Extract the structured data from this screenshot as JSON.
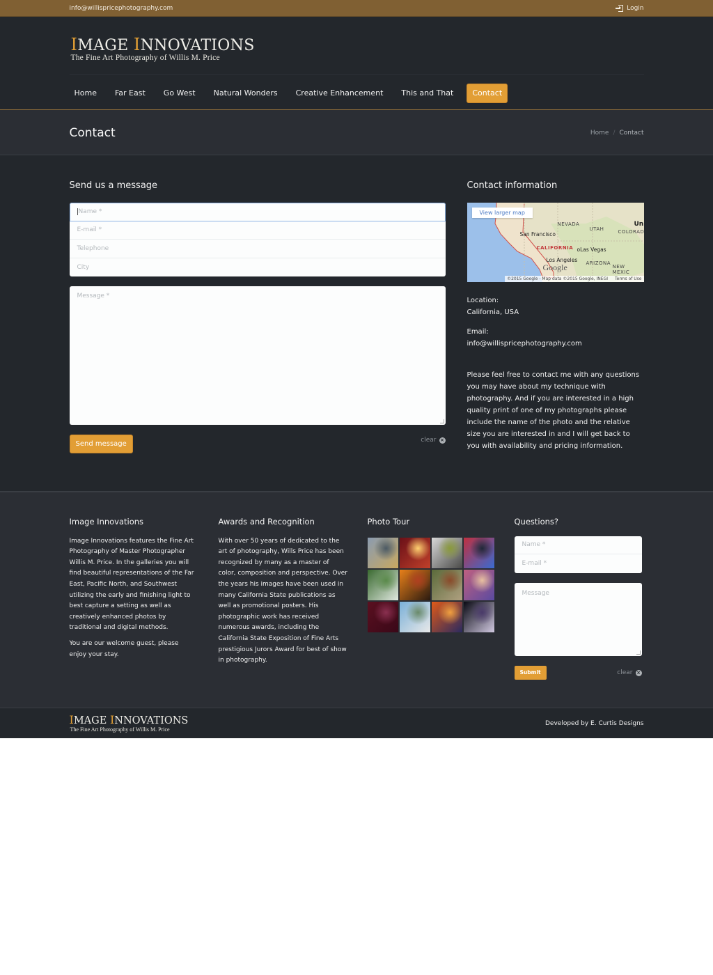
{
  "topbar": {
    "email": "info@willispricephotography.com",
    "login_label": "Login",
    "login_icon": "sign-in-icon"
  },
  "logo": {
    "cap1": "I",
    "rest1": "MAGE ",
    "cap2": "I",
    "rest2": "NNOVATIONS",
    "subtitle": "The Fine Art Photography of Willis M. Price"
  },
  "nav": {
    "items": [
      {
        "label": "Home",
        "active": false
      },
      {
        "label": "Far East",
        "active": false
      },
      {
        "label": "Go West",
        "active": false
      },
      {
        "label": "Natural Wonders",
        "active": false
      },
      {
        "label": "Creative Enhancement",
        "active": false
      },
      {
        "label": "This and That",
        "active": false
      },
      {
        "label": "Contact",
        "active": true
      }
    ]
  },
  "page": {
    "title": "Contact",
    "breadcrumb": [
      "Home",
      "/",
      "Contact"
    ]
  },
  "contact_form": {
    "heading": "Send us a message",
    "fields": [
      {
        "placeholder": "Name *",
        "value": ""
      },
      {
        "placeholder": "E-mail *",
        "value": ""
      },
      {
        "placeholder": "Telephone",
        "value": ""
      },
      {
        "placeholder": "City",
        "value": ""
      }
    ],
    "message_placeholder": "Message *",
    "send_label": "Send message",
    "clear_label": "clear"
  },
  "contact_info": {
    "heading": "Contact information",
    "map": {
      "view_larger": "View larger map",
      "labels": [
        "NEVADA",
        "UTAH",
        "COLORAD",
        "Un",
        "San Francisco",
        "CALIFORNIA",
        "oLas Vegas",
        "Los Angeles",
        "ARIZONA",
        "NEW MEXIC"
      ],
      "google": "Google",
      "attribution": "©2015 Google - Map data ©2015 Google, INEGI",
      "terms": "Terms of Use"
    },
    "location_label": "Location:",
    "location_value": "California, USA",
    "email_label": "Email:",
    "email_value": "info@willispricephotography.com",
    "description": "Please feel free to contact me with any questions you may have about my technique with photography.  And if you are interested in a high quality print of one of my photographs please include the name of the photo and the relative size you are interested in and I will get back to you with availability and pricing information."
  },
  "footer": {
    "col1": {
      "heading": "Image Innovations",
      "p1": "Image Innovations features the Fine Art Photography of Master Photographer Willis M. Price. In the galleries you will find beautiful representations of the Far East, Pacific North, and Southwest utilizing the early and finishing light to best capture a setting as well as creatively enhanced photos by traditional and digital methods.",
      "p2": "You are our welcome guest, please enjoy your stay."
    },
    "col2": {
      "heading": "Awards and Recognition",
      "p1": "With over 50 years of dedicated to the art of photography, Wills Price has been recognized by many as a master of color, composition and perspective. Over the years his images have been used in many California State publications as well as promotional posters. His photographic work has received numerous awards, including the California State Exposition of Fine Arts prestigious Jurors Award for best of show in photography."
    },
    "col3": {
      "heading": "Photo Tour",
      "thumbs": [
        {
          "name": "photo-thumb-architecture",
          "colors": [
            "#8a9bb0",
            "#c8a860",
            "#4c5a64"
          ]
        },
        {
          "name": "photo-thumb-slot-canyon-light",
          "colors": [
            "#6a1018",
            "#c0402a",
            "#ffd070"
          ]
        },
        {
          "name": "photo-thumb-misty-mountain",
          "colors": [
            "#d8d8d8",
            "#4a4a48",
            "#8a9a3a"
          ]
        },
        {
          "name": "photo-thumb-abstract-red-blue",
          "colors": [
            "#c03040",
            "#3a6ad0",
            "#202838"
          ]
        },
        {
          "name": "photo-thumb-flowering-tree",
          "colors": [
            "#3a6a30",
            "#e0e8e0",
            "#5a8a4a"
          ]
        },
        {
          "name": "photo-thumb-sunset-tree",
          "colors": [
            "#e8801a",
            "#2a1a10",
            "#b04020"
          ]
        },
        {
          "name": "photo-thumb-forest-floor",
          "colors": [
            "#5a6a3a",
            "#b0a080",
            "#8a4a2a"
          ]
        },
        {
          "name": "photo-thumb-swirl",
          "colors": [
            "#c06080",
            "#5a4aa0",
            "#e8c0a0"
          ]
        },
        {
          "name": "photo-thumb-canyon-purple",
          "colors": [
            "#5a1020",
            "#3a0818",
            "#8a3050"
          ]
        },
        {
          "name": "photo-thumb-egret",
          "colors": [
            "#7ab0d8",
            "#e8e8e8",
            "#6a8a6a"
          ]
        },
        {
          "name": "photo-thumb-antelope-canyon",
          "colors": [
            "#e05a18",
            "#2a2a60",
            "#f0a040"
          ]
        },
        {
          "name": "photo-thumb-light-streak",
          "colors": [
            "#0a0a14",
            "#d0c8e0",
            "#4a3a6a"
          ]
        }
      ]
    },
    "col4": {
      "heading": "Questions?",
      "fields": [
        {
          "placeholder": "Name *",
          "value": ""
        },
        {
          "placeholder": "E-mail *",
          "value": ""
        }
      ],
      "message_placeholder": "Message",
      "submit_label": "Submit",
      "clear_label": "clear"
    }
  },
  "bottom": {
    "developer": "Developed by E. Curtis Designs"
  },
  "colors": {
    "accent": "#e29e35",
    "topbar": "#806033",
    "background": "#23272c",
    "band": "#2b2e34"
  }
}
